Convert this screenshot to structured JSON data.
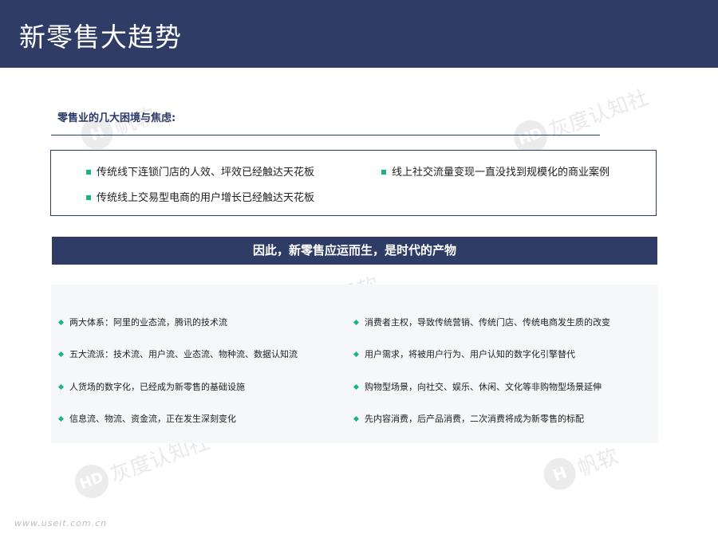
{
  "header": {
    "title": "新零售大趋势"
  },
  "section": {
    "heading": "零售业的几大困境与焦虑:"
  },
  "issues": [
    {
      "text": "传统线下连锁门店的人效、坪效已经触达天花板"
    },
    {
      "text": "线上社交流量变现一直没找到规模化的商业案例"
    },
    {
      "text": "传统线上交易型电商的用户增长已经触达天花板"
    }
  ],
  "banner": {
    "text": "因此，新零售应运而生，是时代的产物"
  },
  "points": {
    "left": [
      {
        "text": "两大体系：阿里的业态流，腾讯的技术流"
      },
      {
        "text": "五大流派：技术流、用户流、业态流、物种流、数据认知流"
      },
      {
        "text": "人货场的数字化，已经成为新零售的基础设施"
      },
      {
        "text": "信息流、物流、资金流，正在发生深刻变化"
      }
    ],
    "right": [
      {
        "text": "消费者主权，导致传统营销、传统门店、传统电商发生质的改变"
      },
      {
        "text": "用户需求，将被用户行为、用户认知的数字化引擎替代"
      },
      {
        "text": "购物型场景，向社交、娱乐、休闲、文化等非购物型场景延伸"
      },
      {
        "text": "先内容消费，后产品消费，二次消费将成为新零售的标配"
      }
    ]
  },
  "watermarks": {
    "brand_a": "帆软",
    "brand_b": "灰度认知社",
    "footer_url": "www.useit.com.cn"
  },
  "colors": {
    "header_bg": "#2f3d66",
    "accent": "#19b58a",
    "heading": "#2b3a67",
    "panel_bg": "#f5f7f8"
  },
  "icons": {
    "issue_bullet": "square-bullet-icon",
    "point_bullet": "diamond-bullet-icon"
  }
}
